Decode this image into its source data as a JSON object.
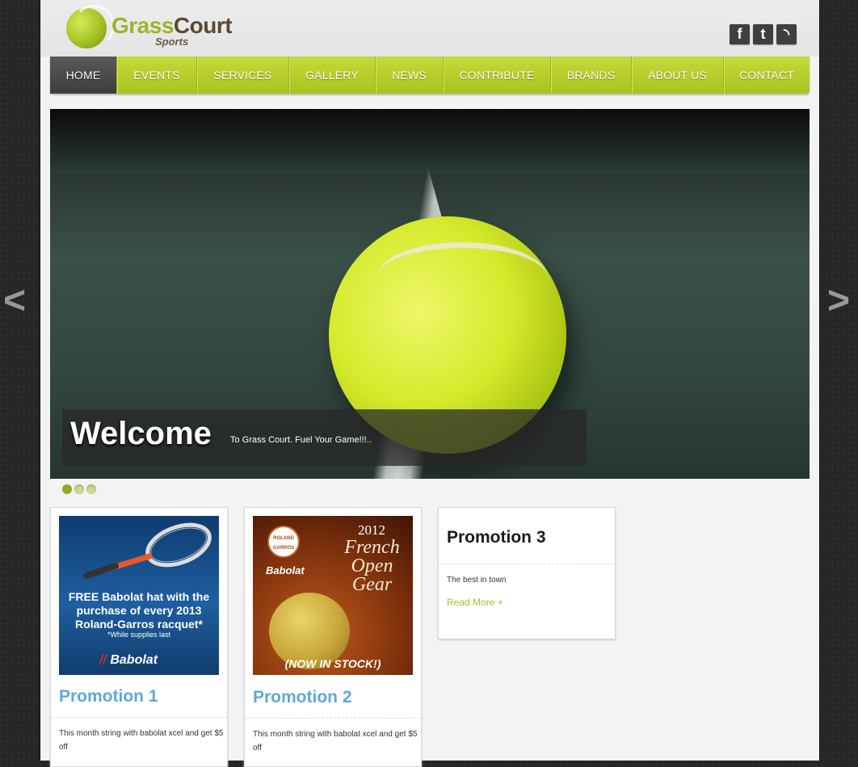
{
  "brand": {
    "name_part1": "Grass",
    "name_part2": "Court",
    "subtitle": "Sports"
  },
  "social": [
    {
      "name": "facebook-icon",
      "glyph": "f"
    },
    {
      "name": "twitter-icon",
      "glyph": "t"
    },
    {
      "name": "rss-icon",
      "glyph": "◝"
    }
  ],
  "nav": {
    "items": [
      {
        "label": "HOME",
        "active": true
      },
      {
        "label": "EVENTS"
      },
      {
        "label": "SERVICES"
      },
      {
        "label": "GALLERY"
      },
      {
        "label": "NEWS"
      },
      {
        "label": "CONTRIBUTE"
      },
      {
        "label": "BRANDS"
      },
      {
        "label": "ABOUT US"
      },
      {
        "label": "CONTACT"
      }
    ]
  },
  "slider": {
    "caption_title": "Welcome",
    "caption_text": "To Grass Court. Fuel Your Game!!!..",
    "prev_arrow": "<",
    "next_arrow": ">",
    "slide_count": 3,
    "active_slide": 1
  },
  "promos": [
    {
      "title": "Promotion 1",
      "text": "This month string with babolat xcel and get $5 off",
      "image": {
        "headline": "FREE Babolat hat with the purchase of every 2013 Roland-Garros racquet*",
        "note": "*While supplies last",
        "brand": "Babolat"
      }
    },
    {
      "title": "Promotion 2",
      "text": "This month string with babolat xcel and get $5 off",
      "image": {
        "year": "2012",
        "headline": "French Open Gear",
        "brand": "Babolat",
        "seal": "ROLAND GARROS",
        "stock": "(NOW IN STOCK!)"
      }
    },
    {
      "title": "Promotion 3",
      "text": "The best in town",
      "read_more": "Read More +"
    }
  ],
  "colors": {
    "accent_green": "#aac21f",
    "promo_title_blue": "#5fa8d8",
    "read_more": "#a8bf2a"
  }
}
